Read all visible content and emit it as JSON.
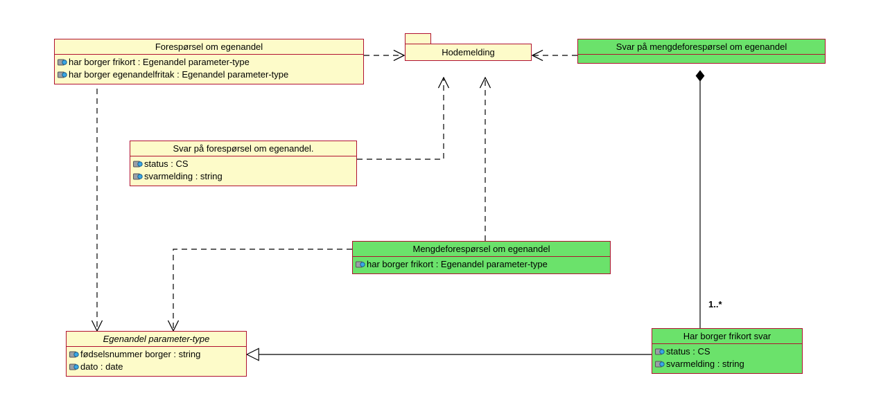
{
  "classes": {
    "foresporsel": {
      "title": "Forespørsel om egenandel",
      "attrs": [
        "har borger frikort : Egenandel parameter-type",
        "har borger egenandelfritak : Egenandel parameter-type"
      ]
    },
    "svar_foresporsel": {
      "title": "Svar på forespørsel om egenandel.",
      "attrs": [
        "status : CS",
        "svarmelding : string"
      ]
    },
    "egenandel_param": {
      "title": "Egenandel parameter-type",
      "attrs": [
        "fødselsnummer borger : string",
        "dato : date"
      ]
    },
    "mengdeforesporsel": {
      "title": "Mengdeforespørsel om egenandel",
      "attrs": [
        "har borger frikort : Egenandel parameter-type"
      ]
    },
    "svar_mengde": {
      "title": "Svar på mengdeforespørsel om egenandel",
      "attrs": []
    },
    "har_borger_frikort_svar": {
      "title": "Har borger frikort svar",
      "attrs": [
        "status : CS",
        "svarmelding : string"
      ]
    }
  },
  "package": {
    "hodemelding": {
      "title": "Hodemelding"
    }
  },
  "multiplicity": {
    "one_many": "1..*"
  }
}
